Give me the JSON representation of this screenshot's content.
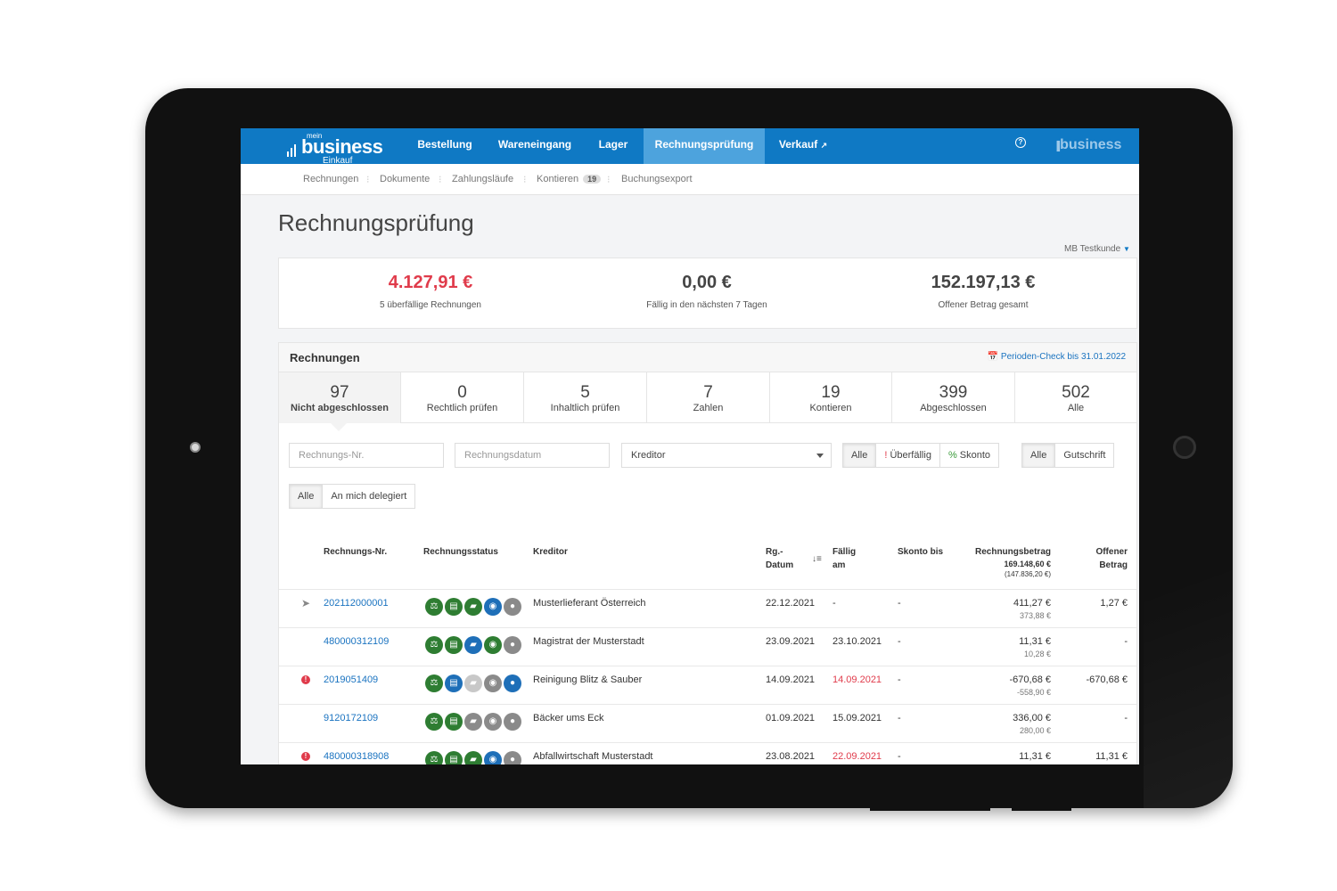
{
  "app": {
    "logo_mein": "mein",
    "logo_brand": "business",
    "logo_sub": "Einkauf",
    "right_logo": "business",
    "help_icon": "?"
  },
  "nav": [
    {
      "label": "Bestellung"
    },
    {
      "label": "Wareneingang"
    },
    {
      "label": "Lager"
    },
    {
      "label": "Rechnungsprüfung"
    },
    {
      "label": "Verkauf"
    }
  ],
  "subnav": {
    "items": [
      "Rechnungen",
      "Dokumente",
      "Zahlungsläufe",
      "Kontieren",
      "Buchungsexport"
    ],
    "kontieren_badge": "19"
  },
  "page_title": "Rechnungsprüfung",
  "customer": "MB Testkunde",
  "kpis": [
    {
      "value": "4.127,91 €",
      "label": "5 überfällige Rechnungen"
    },
    {
      "value": "0,00 €",
      "label": "Fällig in den nächsten 7 Tagen"
    },
    {
      "value": "152.197,13 €",
      "label": "Offener Betrag gesamt"
    }
  ],
  "invoices_panel": {
    "title": "Rechnungen",
    "period_check": "Perioden-Check bis 31.01.2022"
  },
  "tabs": [
    {
      "count": "97",
      "label": "Nicht abgeschlossen"
    },
    {
      "count": "0",
      "label": "Rechtlich prüfen"
    },
    {
      "count": "5",
      "label": "Inhaltlich prüfen"
    },
    {
      "count": "7",
      "label": "Zahlen"
    },
    {
      "count": "19",
      "label": "Kontieren"
    },
    {
      "count": "399",
      "label": "Abgeschlossen"
    },
    {
      "count": "502",
      "label": "Alle"
    }
  ],
  "filters": {
    "invoice_no_placeholder": "Rechnungs-Nr.",
    "invoice_date_placeholder": "Rechnungsdatum",
    "creditor_select": "Kreditor",
    "group1": {
      "all": "Alle",
      "overdue_mark": "!",
      "overdue": "Überfällig",
      "discount_mark": "%",
      "discount": "Skonto"
    },
    "group2": {
      "all": "Alle",
      "credit": "Gutschrift"
    },
    "group3": {
      "all": "Alle",
      "delegated": "An mich delegiert"
    }
  },
  "table": {
    "headers": {
      "invoice_no": "Rechnungs-Nr.",
      "status": "Rechnungsstatus",
      "creditor": "Kreditor",
      "date_line1": "Rg.-",
      "date_line2": "Datum",
      "due_line1": "Fällig",
      "due_line2": "am",
      "discount_until": "Skonto bis",
      "amount": "Rechnungsbetrag",
      "amount_total": "169.148,60 €",
      "amount_total_net": "(147.836,20 €)",
      "open_line1": "Offener",
      "open_line2": "Betrag"
    },
    "rows": [
      {
        "no": "202112000001",
        "creditor": "Musterlieferant Österreich",
        "date": "22.12.2021",
        "due": "-",
        "due_overdue": false,
        "discount": "-",
        "amount": "411,27 €",
        "amount_net": "373,88 €",
        "open": "1,27 €",
        "marker": "send",
        "icons": [
          "g",
          "g",
          "g",
          "b",
          "gr"
        ]
      },
      {
        "no": "480000312109",
        "creditor": "Magistrat der Musterstadt",
        "date": "23.09.2021",
        "due": "23.10.2021",
        "due_overdue": false,
        "discount": "-",
        "amount": "11,31 €",
        "amount_net": "10,28 €",
        "open": "-",
        "marker": "",
        "icons": [
          "g",
          "g",
          "b",
          "g",
          "gr"
        ]
      },
      {
        "no": "2019051409",
        "creditor": "Reinigung Blitz & Sauber",
        "date": "14.09.2021",
        "due": "14.09.2021",
        "due_overdue": true,
        "discount": "-",
        "amount": "-670,68 €",
        "amount_net": "-558,90 €",
        "open": "-670,68 €",
        "marker": "warn",
        "icons": [
          "g",
          "b",
          "lg",
          "gr",
          "b"
        ]
      },
      {
        "no": "9120172109",
        "creditor": "Bäcker ums Eck",
        "date": "01.09.2021",
        "due": "15.09.2021",
        "due_overdue": false,
        "discount": "-",
        "amount": "336,00 €",
        "amount_net": "280,00 €",
        "open": "-",
        "marker": "",
        "icons": [
          "g",
          "g",
          "gr",
          "gr",
          "gr"
        ]
      },
      {
        "no": "480000318908",
        "creditor": "Abfallwirtschaft Musterstadt",
        "date": "23.08.2021",
        "due": "22.09.2021",
        "due_overdue": true,
        "discount": "-",
        "amount": "11,31 €",
        "amount_net": "",
        "open": "11,31 €",
        "marker": "warn",
        "icons": [
          "g",
          "g",
          "g",
          "b",
          "gr"
        ]
      }
    ]
  },
  "colors": {
    "brand_blue": "#0f79c4",
    "active_nav": "#4da3dd",
    "overdue_red": "#e03b4b",
    "link_blue": "#1a73c0"
  }
}
